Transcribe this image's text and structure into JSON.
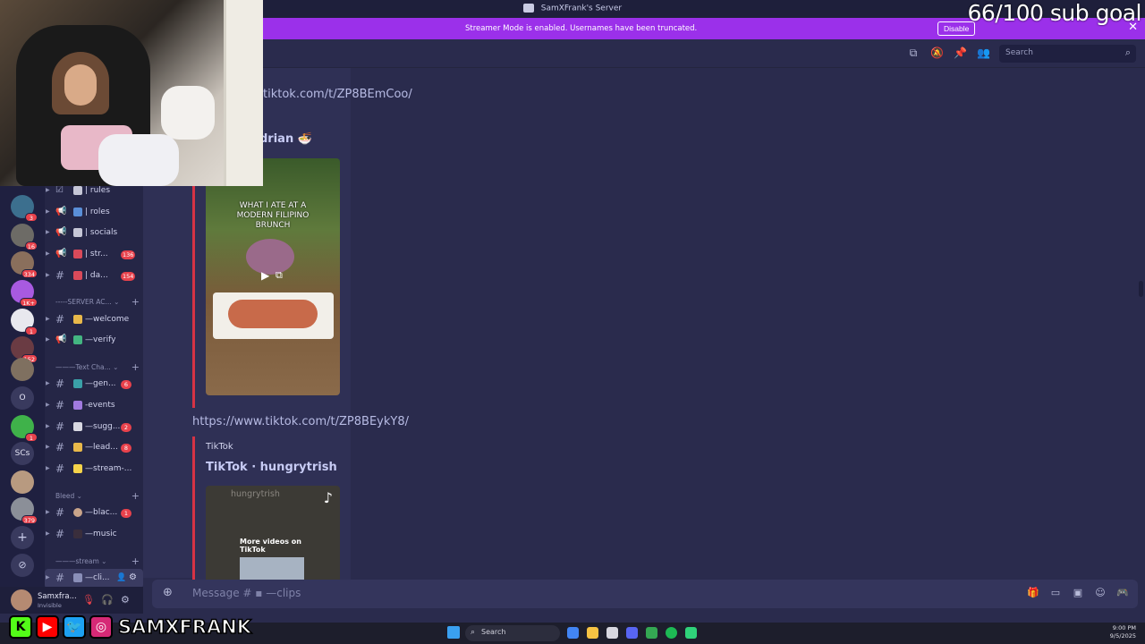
{
  "window": {
    "title": "SamXFrank's Server"
  },
  "overlay": {
    "sub_goal": "66/100 sub goal",
    "handle": "SAMXFRANK"
  },
  "banner": {
    "text": "Streamer Mode is enabled. Usernames have been truncated.",
    "disable_label": "Disable"
  },
  "header": {
    "search_placeholder": "Search"
  },
  "servers": [
    {
      "label": "",
      "badge": "3"
    },
    {
      "label": "",
      "badge": "16"
    },
    {
      "label": "",
      "badge": "334"
    },
    {
      "label": "",
      "badge": "1K+"
    },
    {
      "label": "",
      "badge": "1"
    },
    {
      "label": "",
      "badge": "152"
    },
    {
      "label": "",
      "badge": ""
    },
    {
      "label": "O",
      "badge": ""
    },
    {
      "label": "",
      "badge": "1"
    },
    {
      "label": "SCs",
      "badge": ""
    },
    {
      "label": "",
      "badge": ""
    },
    {
      "label": "",
      "badge": "379"
    }
  ],
  "channels": {
    "items": [
      {
        "name": "| rules",
        "badge": ""
      },
      {
        "name": "| roles",
        "badge": ""
      },
      {
        "name": "| socials",
        "badge": ""
      },
      {
        "name": "| str...",
        "badge": "136"
      },
      {
        "name": "| da...",
        "badge": "154"
      },
      {
        "name": "—welcome",
        "badge": ""
      },
      {
        "name": "—verify",
        "badge": ""
      },
      {
        "name": "—gen...",
        "badge": "6"
      },
      {
        "name": "-events",
        "badge": ""
      },
      {
        "name": "—sugg...",
        "badge": "2"
      },
      {
        "name": "—lead...",
        "badge": "8"
      },
      {
        "name": "—stream-...",
        "badge": ""
      },
      {
        "name": "—blac...",
        "badge": "1"
      },
      {
        "name": "—music",
        "badge": ""
      },
      {
        "name": "—cli...",
        "badge": ""
      }
    ],
    "categories": {
      "server_access": "-----SERVER AC... ⌄",
      "text_chat": "———Text Cha... ⌄",
      "bleed": "Bleed ⌄",
      "stream": "———stream ⌄"
    }
  },
  "user": {
    "name": "Samxfra...",
    "status": "Invisible"
  },
  "messages": {
    "link1": "tiktok.com/t/ZP8BEmCoo/",
    "embed1_title": "drian 🍜",
    "thumb1_caption": "WHAT I ATE AT A MODERN FILIPINO BRUNCH",
    "link2": "https://www.tiktok.com/t/ZP8BEykY8/",
    "embed2_provider": "TikTok",
    "embed2_title": "TikTok · hungrytrish",
    "thumb2_user": "hungrytrish",
    "thumb2_more": "More videos on TikTok"
  },
  "composer": {
    "placeholder": "Message # ▪ —clips"
  },
  "taskbar": {
    "search_label": "Search",
    "time": "9:00 PM",
    "date": "9/5/2025"
  }
}
